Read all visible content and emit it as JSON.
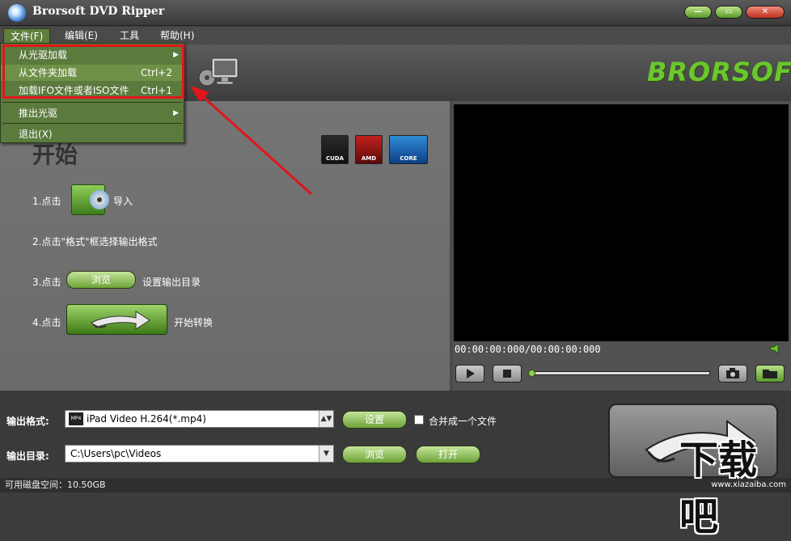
{
  "window": {
    "title": "Brorsoft DVD Ripper"
  },
  "menubar": {
    "items": [
      {
        "label": "文件(F)"
      },
      {
        "label": "编辑(E)"
      },
      {
        "label": "工具"
      },
      {
        "label": "帮助(H)"
      }
    ]
  },
  "file_menu": {
    "items": [
      {
        "label": "从光驱加载",
        "shortcut": ""
      },
      {
        "label": "从文件夹加载",
        "shortcut": "Ctrl+2"
      },
      {
        "label": "加载IFO文件或者ISO文件",
        "shortcut": "Ctrl+1"
      },
      {
        "label": "推出光驱",
        "shortcut": ""
      },
      {
        "label": "退出(X)",
        "shortcut": ""
      }
    ]
  },
  "brand": {
    "text": "BRORSOFT"
  },
  "start": {
    "title": "开始",
    "badges": [
      {
        "label": "CUDA"
      },
      {
        "label": "AMD"
      },
      {
        "label": "CORE"
      }
    ],
    "step1": {
      "prefix": "1.点击",
      "suffix": "导入"
    },
    "step2": {
      "text": "2.点击\"格式\"框选择输出格式"
    },
    "step3": {
      "prefix": "3.点击",
      "button": "浏览",
      "suffix": "设置输出目录"
    },
    "step4": {
      "prefix": "4.点击",
      "suffix": "开始转换"
    }
  },
  "player": {
    "timecode": "00:00:00:000/00:00:00:000",
    "progress": 0
  },
  "output": {
    "format_label": "输出格式:",
    "format_value": "iPad Video H.264(*.mp4)",
    "settings_button": "设置",
    "merge_label": "合并成一个文件",
    "merge_checked": false,
    "dir_label": "输出目录:",
    "dir_value": "C:\\Users\\pc\\Videos",
    "browse_button": "浏览",
    "open_button": "打开"
  },
  "status": {
    "disk_space": "可用磁盘空间：10.50GB"
  },
  "watermark": {
    "text": "下载吧",
    "url": "www.xiazaiba.com"
  },
  "colors": {
    "accent_green": "#6bc72c",
    "menu_green": "#5b7a3d",
    "highlight_red": "#e0161b"
  }
}
